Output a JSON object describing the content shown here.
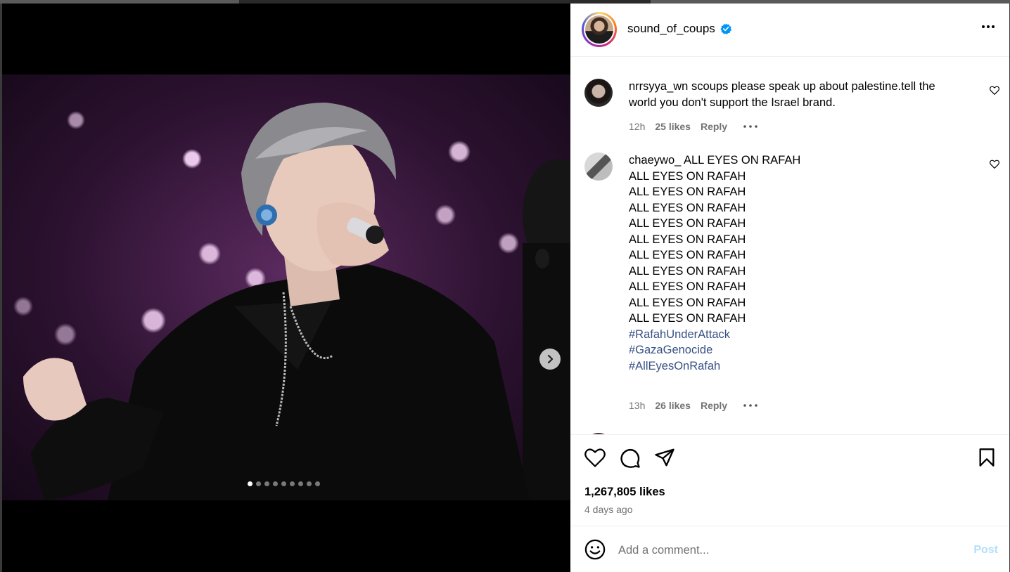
{
  "post": {
    "username": "sound_of_coups",
    "likes": "1,267,805 likes",
    "date": "4 days ago",
    "carousel": {
      "total": 9,
      "active": 0
    }
  },
  "comments": [
    {
      "username": "nrrsyya_wn",
      "text": "scoups please speak up about palestine.tell the world you don't support the Israel brand.",
      "time": "12h",
      "likes": "25 likes",
      "reply": "Reply"
    },
    {
      "username": "chaeywo_",
      "lines": [
        "ALL EYES ON RAFAH",
        "ALL EYES ON RAFAH",
        "ALL EYES ON RAFAH",
        "ALL EYES ON RAFAH",
        "ALL EYES ON RAFAH",
        "ALL EYES ON RAFAH",
        "ALL EYES ON RAFAH",
        "ALL EYES ON RAFAH",
        "ALL EYES ON RAFAH",
        "ALL EYES ON RAFAH",
        "ALL EYES ON RAFAH"
      ],
      "hashtags": [
        "#RafahUnderAttack",
        "#GazaGenocide",
        "#AllEyesOnRafah"
      ],
      "time": "13h",
      "likes": "26 likes",
      "reply": "Reply"
    }
  ],
  "add_comment": {
    "placeholder": "Add a comment...",
    "post_label": "Post"
  },
  "colors": {
    "link": "#385185",
    "muted": "#737373",
    "verified": "#0095f6",
    "post_disabled": "#b2dffc"
  }
}
